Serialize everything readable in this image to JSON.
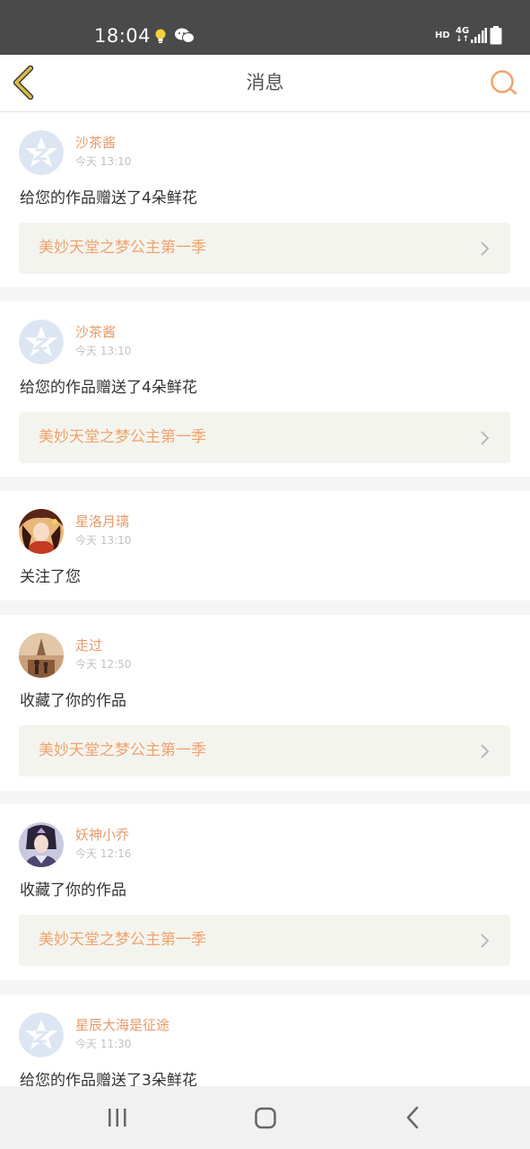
{
  "status_bar": {
    "time": "18:04",
    "hd": "HD",
    "network": "4G",
    "network_arrows": "↓↑",
    "icons": [
      "bulb-notification-icon",
      "wechat-icon",
      "signal-icon",
      "battery-icon"
    ]
  },
  "header": {
    "title": "消息",
    "back_icon": "chevron-left-icon",
    "search_icon": "search-icon"
  },
  "messages": [
    {
      "name": "沙茶酱",
      "time": "今天 13:10",
      "text": "给您的作品赠送了4朵鲜花",
      "work": "美妙天堂之梦公主第一季",
      "avatar": "default-avatar-icon"
    },
    {
      "name": "沙茶酱",
      "time": "今天 13:10",
      "text": "给您的作品赠送了4朵鲜花",
      "work": "美妙天堂之梦公主第一季",
      "avatar": "default-avatar-icon"
    },
    {
      "name": "星洛月璃",
      "time": "今天 13:10",
      "text": "关注了您",
      "avatar": "user-avatar"
    },
    {
      "name": "走过",
      "time": "今天 12:50",
      "text": "收藏了你的作品",
      "work": "美妙天堂之梦公主第一季",
      "avatar": "user-avatar"
    },
    {
      "name": "妖神小乔",
      "time": "今天 12:16",
      "text": "收藏了你的作品",
      "work": "美妙天堂之梦公主第一季",
      "avatar": "user-avatar"
    },
    {
      "name": "星辰大海是征途",
      "time": "今天 11:30",
      "text": "给您的作品赠送了3朵鲜花",
      "avatar": "default-avatar-icon"
    }
  ],
  "nav_bar": {
    "icons": [
      "recent-apps-icon",
      "home-icon",
      "back-icon"
    ]
  },
  "colors": {
    "accent": "#e89a6a",
    "work_title": "#f0a36c",
    "work_bg": "#f4f4ee",
    "status_bar": "#4a4a4a",
    "back_arrow": "#d9b53c",
    "default_avatar": "#dce6f2"
  }
}
